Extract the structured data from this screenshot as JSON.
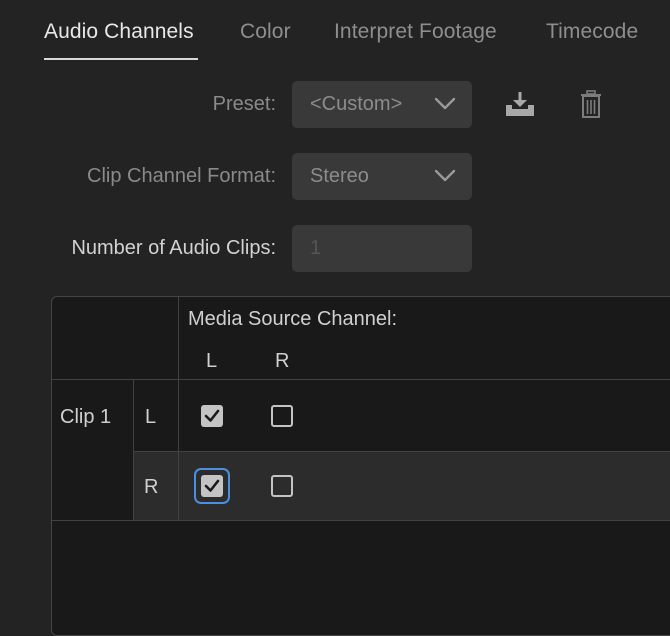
{
  "tabs": [
    {
      "label": "Audio Channels",
      "active": true
    },
    {
      "label": "Color",
      "active": false
    },
    {
      "label": "Interpret Footage",
      "active": false
    },
    {
      "label": "Timecode",
      "active": false
    }
  ],
  "preset": {
    "label": "Preset:",
    "value": "<Custom>",
    "save_icon": "save-preset-icon",
    "delete_icon": "trash-icon"
  },
  "clip_channel_format": {
    "label": "Clip Channel Format:",
    "value": "Stereo"
  },
  "number_of_audio_clips": {
    "label": "Number of Audio Clips:",
    "value": "1"
  },
  "table": {
    "header": "Media Source Channel:",
    "source_columns": [
      "L",
      "R"
    ],
    "clips": [
      {
        "name": "Clip 1",
        "rows": [
          {
            "channel": "L",
            "checks": [
              true,
              false
            ]
          },
          {
            "channel": "R",
            "checks": [
              true,
              false
            ]
          }
        ]
      }
    ]
  },
  "colors": {
    "background": "#232323",
    "accent_focus": "#4a8fe0",
    "field": "#393939"
  }
}
